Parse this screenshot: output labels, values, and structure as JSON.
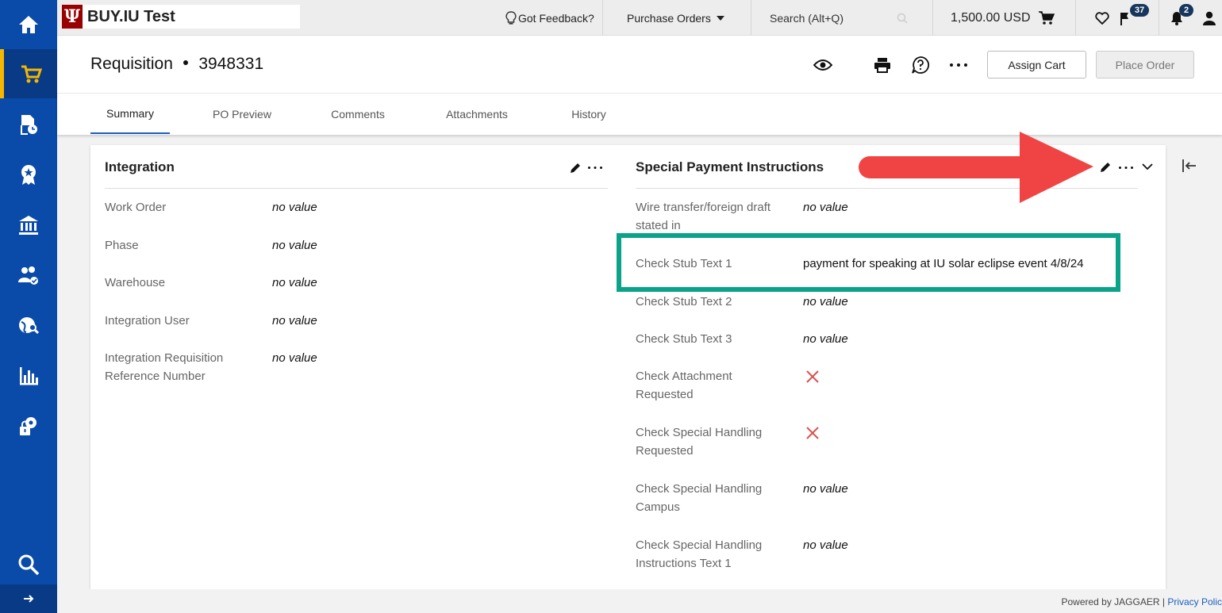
{
  "brand": {
    "name": "BUY.IU Test",
    "logo": "Ψ"
  },
  "topbar": {
    "feedback": "Got Feedback?",
    "menu": "Purchase Orders",
    "search_placeholder": "Search (Alt+Q)",
    "cart_total": "1,500.00 USD",
    "flag_count": "37",
    "notification_count": "2"
  },
  "header": {
    "doc_type": "Requisition",
    "doc_number": "3948331",
    "assign_cart": "Assign Cart",
    "place_order": "Place Order"
  },
  "tabs": [
    "Summary",
    "PO Preview",
    "Comments",
    "Attachments",
    "History"
  ],
  "integration": {
    "title": "Integration",
    "fields": [
      {
        "label": "Work Order",
        "value": "no value"
      },
      {
        "label": "Phase",
        "value": "no value"
      },
      {
        "label": "Warehouse",
        "value": "no value"
      },
      {
        "label": "Integration User",
        "value": "no value"
      },
      {
        "label_line1": "Integration Requisition",
        "label_line2": "Reference Number",
        "value": "no value"
      }
    ]
  },
  "special_payment": {
    "title": "Special Payment Instructions",
    "fields": [
      {
        "label_line1": "Wire transfer/foreign draft",
        "label_line2": "stated in",
        "value": "no value"
      },
      {
        "label": "Check Stub Text 1",
        "value": "payment for speaking at IU solar eclipse event 4/8/24"
      },
      {
        "label": "Check Stub Text 2",
        "value": "no value"
      },
      {
        "label": "Check Stub Text 3",
        "value": "no value"
      },
      {
        "label_line1": "Check Attachment",
        "label_line2": "Requested"
      },
      {
        "label_line1": "Check Special Handling",
        "label_line2": "Requested"
      },
      {
        "label_line1": "Check Special Handling",
        "label_line2": "Campus",
        "value": "no value"
      },
      {
        "label_line1": "Check Special Handling",
        "label_line2": "Instructions Text 1",
        "value": "no value"
      }
    ]
  },
  "footer": {
    "powered": "Powered by JAGGAER | ",
    "privacy": "Privacy Polic"
  },
  "colors": {
    "sidebar": "#0a4ba9",
    "accent": "#f5b700",
    "highlight": "#0aa38a",
    "arrow": "#f04444",
    "xmark": "#d9534f"
  }
}
